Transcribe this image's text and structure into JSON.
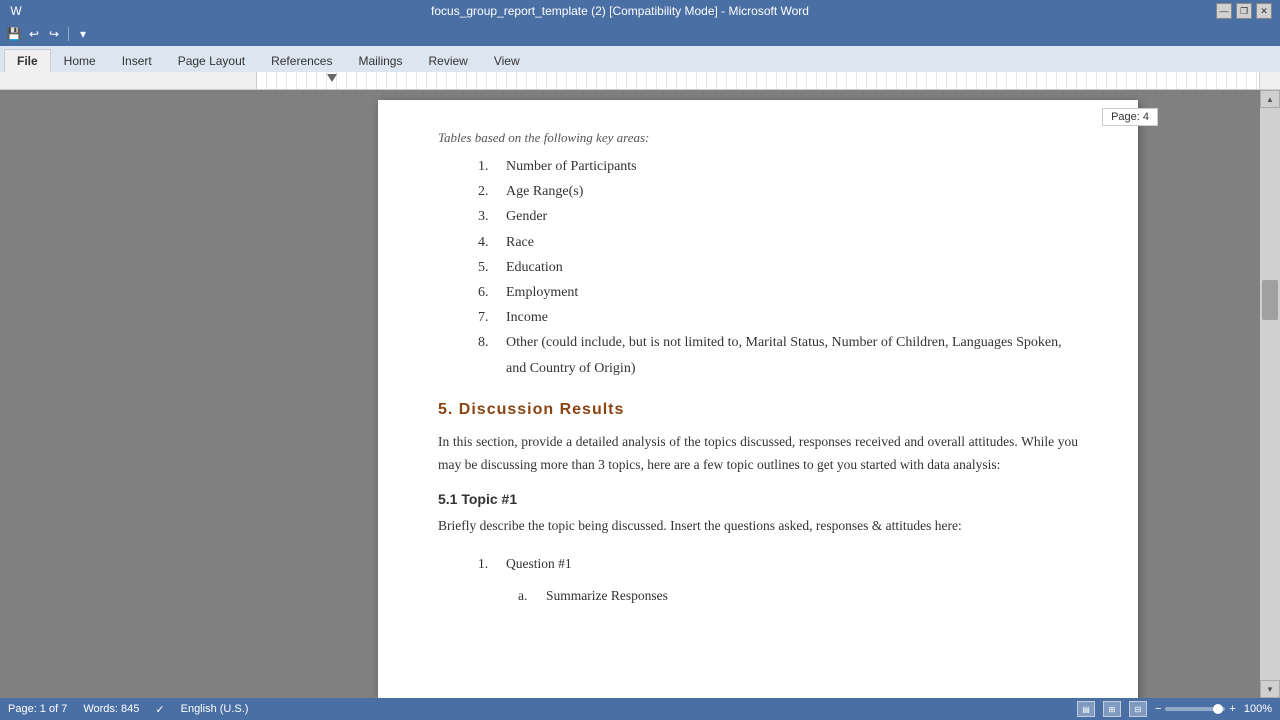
{
  "titleBar": {
    "text": "focus_group_report_template (2) [Compatibility Mode] - Microsoft Word",
    "minBtn": "—",
    "maxBtn": "❐",
    "closeBtn": "✕"
  },
  "ribbonTabs": [
    {
      "label": "File",
      "active": true
    },
    {
      "label": "Home",
      "active": false
    },
    {
      "label": "Insert",
      "active": false
    },
    {
      "label": "Page Layout",
      "active": false
    },
    {
      "label": "References",
      "active": false
    },
    {
      "label": "Mailings",
      "active": false
    },
    {
      "label": "Review",
      "active": false
    },
    {
      "label": "View",
      "active": false
    }
  ],
  "pageLabel": "Page: 4",
  "introText": "Tables based on the following key areas:",
  "numberedItems": [
    {
      "num": "1.",
      "text": "Number of Participants"
    },
    {
      "num": "2.",
      "text": "Age Range(s)"
    },
    {
      "num": "3.",
      "text": "Gender"
    },
    {
      "num": "4.",
      "text": "Race"
    },
    {
      "num": "5.",
      "text": "Education"
    },
    {
      "num": "6.",
      "text": "Employment"
    },
    {
      "num": "7.",
      "text": "Income"
    },
    {
      "num": "8.",
      "text": "Other (could include, but is not limited to, Marital Status, Number of Children, Languages Spoken, and Country of Origin)"
    }
  ],
  "section5": {
    "heading": "5.  Discussion  Results",
    "body": "In this section, provide a detailed analysis of the topics discussed, responses received and overall attitudes.  While you may be discussing more than 3 topics, here are a few topic outlines to get you started with data analysis:"
  },
  "section51": {
    "heading": "5.1 Topic #1",
    "body": "Briefly describe the topic being discussed.   Insert the questions asked, responses & attitudes here:"
  },
  "question1": {
    "num": "1.",
    "text": "Question #1"
  },
  "summarize": {
    "letter": "a.",
    "text": "Summarize Responses"
  },
  "statusBar": {
    "page": "Page: 1 of 7",
    "words": "Words: 845",
    "language": "English (U.S.)",
    "zoom": "100%"
  }
}
